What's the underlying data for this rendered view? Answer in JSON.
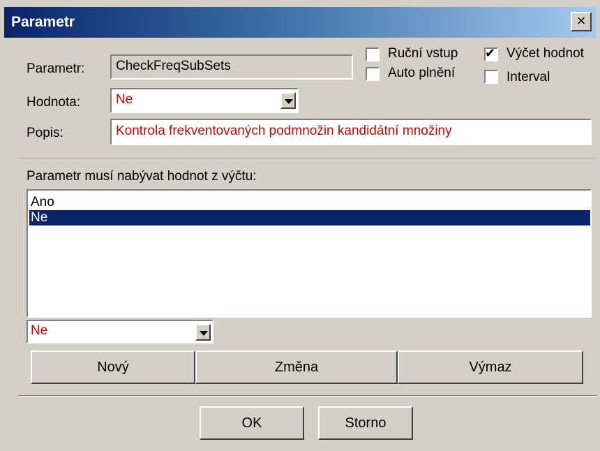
{
  "window": {
    "title": "Parametr",
    "close_label": "×"
  },
  "form": {
    "parametr_label": "Parametr:",
    "parametr_value": "CheckFreqSubSets",
    "hodnota_label": "Hodnota:",
    "hodnota_value": "Ne",
    "popis_label": "Popis:",
    "popis_value": "Kontrola frekventovaných podmnožin kandidátní množiny"
  },
  "checkboxes": {
    "rucni_vstup": {
      "label": "Ruční vstup",
      "checked": false
    },
    "auto_plneni": {
      "label": "Auto plnění",
      "checked": false
    },
    "vycet_hodnot": {
      "label": "Výčet hodnot",
      "checked": true
    },
    "interval": {
      "label": "Interval",
      "checked": false
    }
  },
  "list": {
    "label": "Parametr musí nabývat hodnot z výčtu:",
    "items": [
      "Ano",
      "Ne"
    ],
    "selected_index": 1,
    "combo_value": "Ne"
  },
  "actions": {
    "novy": "Nový",
    "zmena": "Změna",
    "vymaz": "Výmaz"
  },
  "footer": {
    "ok": "OK",
    "storno": "Storno"
  },
  "colors": {
    "title_start": "#0a246a",
    "title_end": "#a6caf0",
    "face": "#d4d0c8",
    "value_red": "#d40000",
    "selection": "#0a246a"
  }
}
